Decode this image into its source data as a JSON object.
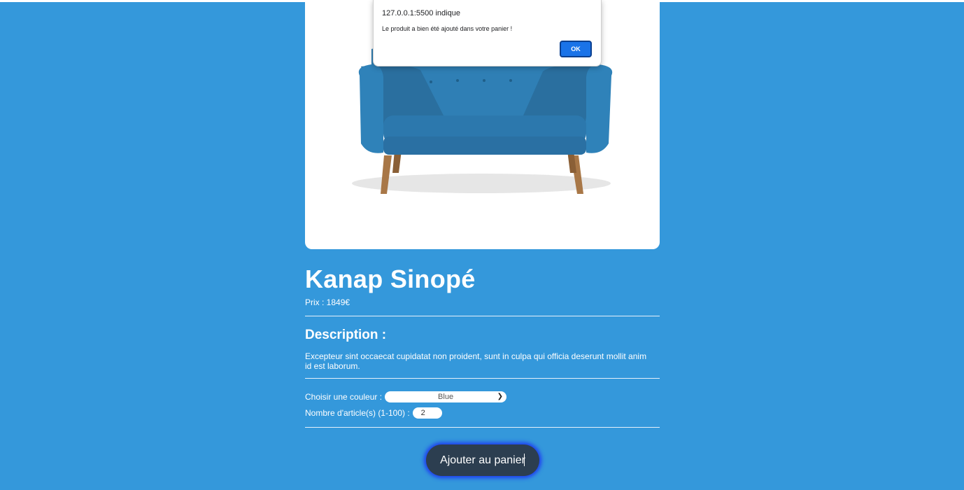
{
  "product": {
    "name": "Kanap Sinopé",
    "price": "Prix : 1849€",
    "description_heading": "Description :",
    "description": "Excepteur sint occaecat cupidatat non proident, sunt in culpa qui officia deserunt mollit anim id est laborum.",
    "image_alt": "Photographie d'un canapé bleu"
  },
  "form": {
    "color_label": "Choisir une couleur :",
    "color_selected": "Blue",
    "quantity_label": "Nombre d'article(s) (1-100) :",
    "quantity_value": "2",
    "add_button": "Ajouter au panier"
  },
  "alert": {
    "title": "127.0.0.1:5500 indique",
    "message": "Le produit a bien été ajouté dans votre panier !",
    "ok_label": "OK"
  },
  "colors": {
    "background": "#3498db",
    "button": "#2c3e50",
    "alert_button": "#1a73e8",
    "sofa": "#2e7fb4"
  }
}
